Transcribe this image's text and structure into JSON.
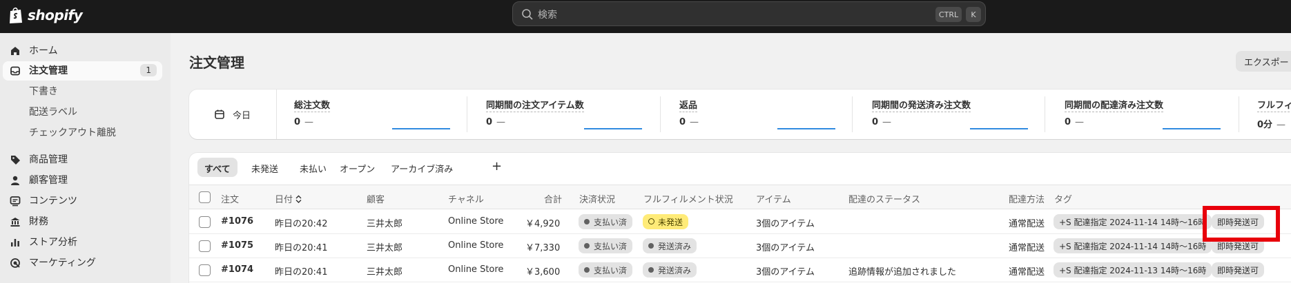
{
  "app": {
    "logo_text": "shopify"
  },
  "search": {
    "placeholder": "検索",
    "shortcut_ctrl": "CTRL",
    "shortcut_key": "K"
  },
  "sidebar": {
    "items": [
      {
        "label": "ホーム",
        "icon": "home-icon"
      },
      {
        "label": "注文管理",
        "icon": "orders-icon",
        "badge": "1",
        "active": true
      },
      {
        "label": "下書き",
        "sub": true
      },
      {
        "label": "配送ラベル",
        "sub": true
      },
      {
        "label": "チェックアウト離脱",
        "sub": true
      },
      {
        "label": "商品管理",
        "icon": "tag-icon"
      },
      {
        "label": "顧客管理",
        "icon": "person-icon"
      },
      {
        "label": "コンテンツ",
        "icon": "content-icon"
      },
      {
        "label": "財務",
        "icon": "bank-icon"
      },
      {
        "label": "ストア分析",
        "icon": "chart-icon"
      },
      {
        "label": "マーケティング",
        "icon": "target-icon"
      }
    ]
  },
  "main": {
    "title": "注文管理",
    "export_label": "エクスポート"
  },
  "stats": {
    "today_label": "今日",
    "items": [
      {
        "label": "総注文数",
        "value": "0",
        "dash": "—"
      },
      {
        "label": "同期間の注文アイテム数",
        "value": "0",
        "dash": "—"
      },
      {
        "label": "返品",
        "value": "0",
        "dash": "—"
      },
      {
        "label": "同期間の発送済み注文数",
        "value": "0",
        "dash": "—"
      },
      {
        "label": "同期間の配達済み注文数",
        "value": "0",
        "dash": "—"
      },
      {
        "label": "フルフィ",
        "value": "0分",
        "dash": "—"
      }
    ]
  },
  "tabs": [
    "すべて",
    "未発送",
    "未払い",
    "オープン",
    "アーカイブ済み",
    "+"
  ],
  "table": {
    "headers": {
      "order": "注文",
      "date": "日付",
      "customer": "顧客",
      "channel": "チャネル",
      "total": "合計",
      "payment": "決済状況",
      "fulfillment": "フルフィルメント状況",
      "items": "アイテム",
      "delivery_status": "配達のステータス",
      "delivery_method": "配達方法",
      "tags": "タグ"
    },
    "rows": [
      {
        "order": "#1076",
        "date": "昨日の20:42",
        "customer": "三井太郎",
        "channel": "Online Store",
        "total": "￥4,920",
        "payment": "支払い済",
        "fulfillment": "未発送",
        "fulfillment_style": "warn",
        "items": "3個のアイテム",
        "delivery_status": "",
        "delivery_method": "通常配送",
        "tag1": "+S 配達指定 2024-11-14 14時〜16時",
        "tag2": "即時発送可"
      },
      {
        "order": "#1075",
        "date": "昨日の20:41",
        "customer": "三井太郎",
        "channel": "Online Store",
        "total": "￥7,330",
        "payment": "支払い済",
        "fulfillment": "発送済み",
        "fulfillment_style": "neutral",
        "items": "3個のアイテム",
        "delivery_status": "",
        "delivery_method": "通常配送",
        "tag1": "+S 配達指定 2024-11-14 14時〜16時",
        "tag2": "即時発送可"
      },
      {
        "order": "#1074",
        "date": "昨日の20:41",
        "customer": "三井太郎",
        "channel": "Online Store",
        "total": "￥3,600",
        "payment": "支払い済",
        "fulfillment": "発送済み",
        "fulfillment_style": "neutral",
        "items": "3個のアイテム",
        "delivery_status": "追跡情報が追加されました",
        "delivery_method": "通常配送",
        "tag1": "+S 配達指定 2024-11-13 14時〜16時",
        "tag2": "即時発送可"
      }
    ]
  },
  "colors": {
    "topbar": "#1a1a1a",
    "highlight": "#e8000b",
    "warn_badge": "#ffeb78",
    "chart_line": "#2f8ae0"
  }
}
